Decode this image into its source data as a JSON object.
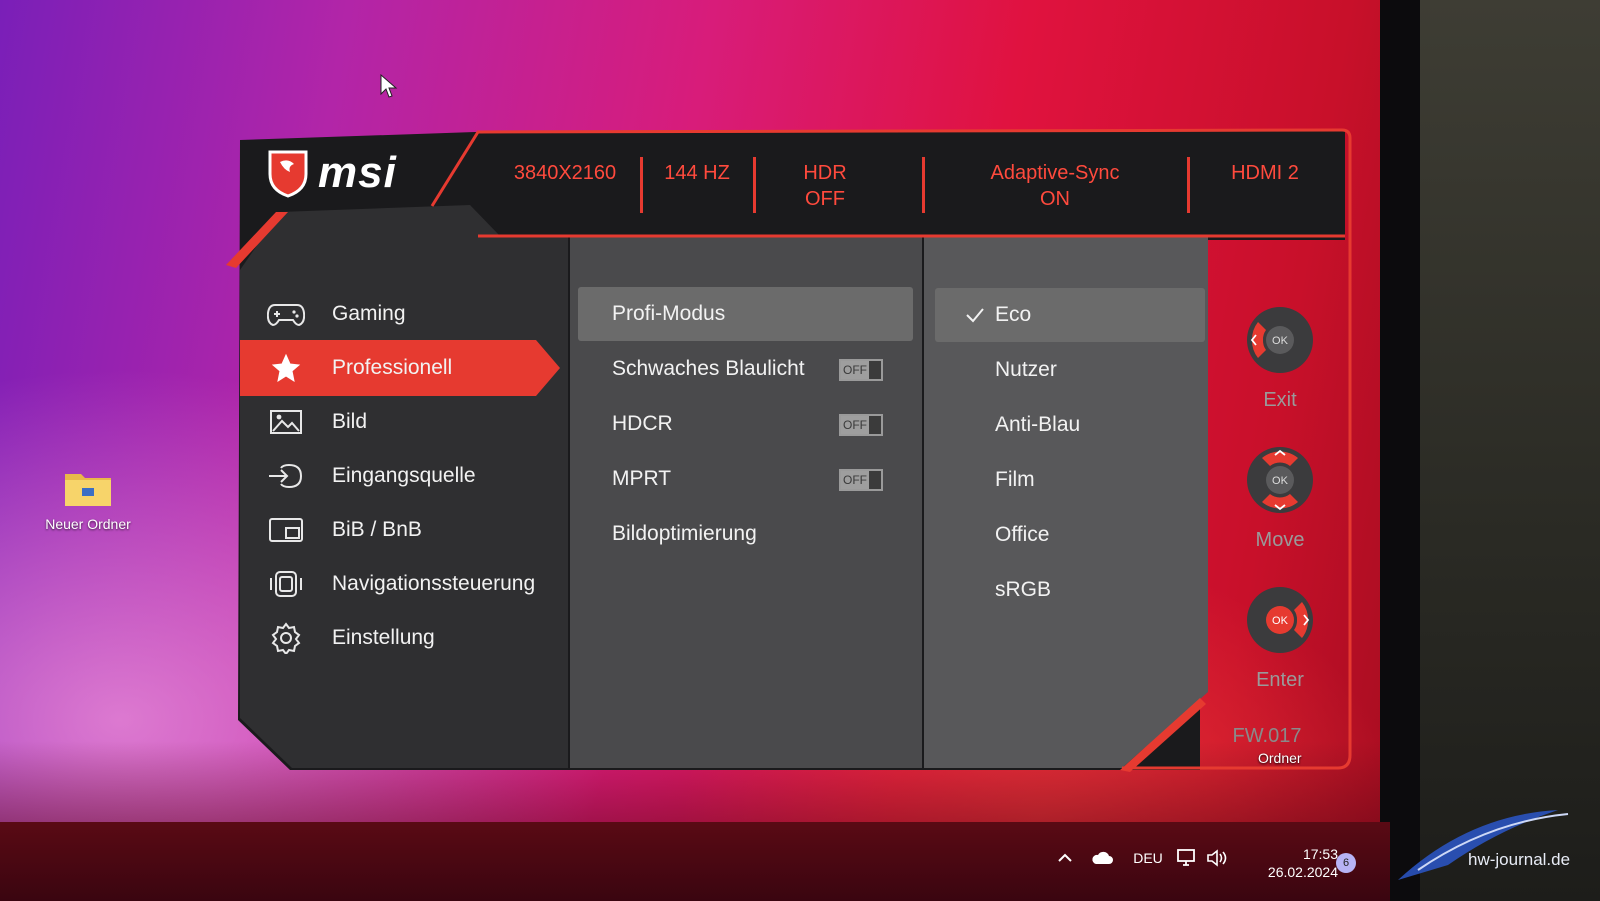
{
  "desktop": {
    "folder_label": "Neuer Ordner",
    "partial_label": "Ordner"
  },
  "taskbar": {
    "language": "DEU",
    "time": "17:53",
    "date": "26.02.2024",
    "notification_count": "6"
  },
  "watermark": "hw-journal.de",
  "osd": {
    "brand": "msi",
    "status_bar": [
      {
        "text": "3840X2160"
      },
      {
        "text": "144 HZ"
      },
      {
        "text": "HDR\nOFF"
      },
      {
        "text": "Adaptive-Sync\nON"
      },
      {
        "text": "HDMI 2"
      }
    ],
    "status_bar_lines": {
      "resolution": "3840X2160",
      "refresh": "144 HZ",
      "hdr_line1": "HDR",
      "hdr_line2": "OFF",
      "sync_line1": "Adaptive-Sync",
      "sync_line2": "ON",
      "input": "HDMI 2"
    },
    "main_menu": [
      {
        "label": "Gaming",
        "icon": "gamepad-icon"
      },
      {
        "label": "Professionell",
        "icon": "star-icon",
        "active": true
      },
      {
        "label": "Bild",
        "icon": "image-icon"
      },
      {
        "label": "Eingangsquelle",
        "icon": "input-source-icon"
      },
      {
        "label": "BiB / BnB",
        "icon": "pip-icon"
      },
      {
        "label": "Navigationssteuerung",
        "icon": "navigation-icon"
      },
      {
        "label": "Einstellung",
        "icon": "gear-icon"
      }
    ],
    "sub_menu": [
      {
        "label": "Profi-Modus",
        "selected": true
      },
      {
        "label": "Schwaches Blaulicht",
        "toggle": "OFF"
      },
      {
        "label": "HDCR",
        "toggle": "OFF"
      },
      {
        "label": "MPRT",
        "toggle": "OFF"
      },
      {
        "label": "Bildoptimierung"
      }
    ],
    "options": [
      {
        "label": "Eco",
        "checked": true
      },
      {
        "label": "Nutzer"
      },
      {
        "label": "Anti-Blau"
      },
      {
        "label": "Film"
      },
      {
        "label": "Office"
      },
      {
        "label": "sRGB"
      }
    ],
    "controls": [
      {
        "label": "Exit",
        "center": "OK"
      },
      {
        "label": "Move",
        "center": "OK"
      },
      {
        "label": "Enter",
        "center": "OK"
      }
    ],
    "firmware": "FW.017"
  },
  "colors": {
    "accent": "#e63a30",
    "accent_text": "#ff4a3d",
    "panel_dark": "#1c1c1e",
    "panel_mid": "#4a4a4c",
    "panel_right": "#555557",
    "selected_row": "#6b6b6b"
  }
}
